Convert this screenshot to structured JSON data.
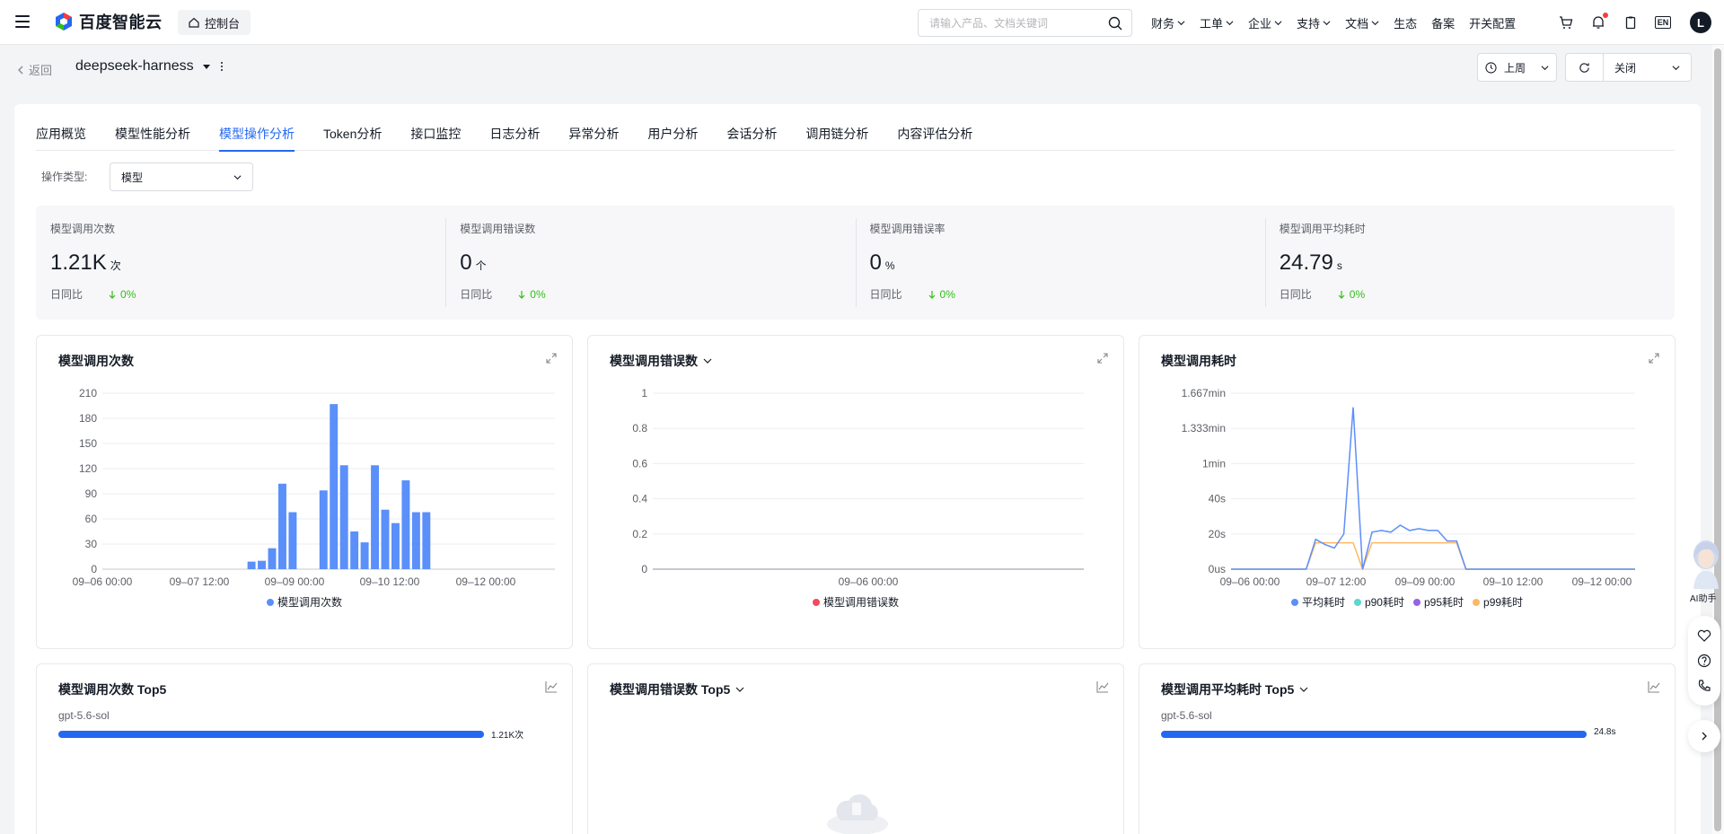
{
  "topnav": {
    "brand": "百度智能云",
    "console_label": "控制台",
    "search_placeholder": "请输入产品、文档关键词",
    "menu": [
      {
        "label": "财务",
        "has_dropdown": true
      },
      {
        "label": "工单",
        "has_dropdown": true
      },
      {
        "label": "企业",
        "has_dropdown": true
      },
      {
        "label": "支持",
        "has_dropdown": true
      },
      {
        "label": "文档",
        "has_dropdown": true
      },
      {
        "label": "生态",
        "has_dropdown": false
      },
      {
        "label": "备案",
        "has_dropdown": false
      },
      {
        "label": "开关配置",
        "has_dropdown": false
      }
    ],
    "lang": "EN",
    "avatar": "L"
  },
  "header": {
    "back_label": "返回",
    "app_name": "deepseek-harness",
    "time_range": "上周",
    "refresh_label": "关闭"
  },
  "tabs": [
    {
      "label": "应用概览",
      "active": false
    },
    {
      "label": "模型性能分析",
      "active": false
    },
    {
      "label": "模型操作分析",
      "active": true
    },
    {
      "label": "Token分析",
      "active": false
    },
    {
      "label": "接口监控",
      "active": false
    },
    {
      "label": "日志分析",
      "active": false
    },
    {
      "label": "异常分析",
      "active": false
    },
    {
      "label": "用户分析",
      "active": false
    },
    {
      "label": "会话分析",
      "active": false
    },
    {
      "label": "调用链分析",
      "active": false
    },
    {
      "label": "内容评估分析",
      "active": false
    }
  ],
  "filter": {
    "label": "操作类型:",
    "value": "模型"
  },
  "stats": [
    {
      "label": "模型调用次数",
      "value": "1.21K",
      "unit": "次",
      "compare_label": "日同比",
      "compare_value": "0%"
    },
    {
      "label": "模型调用错误数",
      "value": "0",
      "unit": "个",
      "compare_label": "日同比",
      "compare_value": "0%"
    },
    {
      "label": "模型调用错误率",
      "value": "0",
      "unit": "%",
      "compare_label": "日同比",
      "compare_value": "0%"
    },
    {
      "label": "模型调用平均耗时",
      "value": "24.79",
      "unit": "s",
      "compare_label": "日同比",
      "compare_value": "0%"
    }
  ],
  "colors": {
    "accent": "#2468f2",
    "bar": "#5b8ff9",
    "error": "#f5495c",
    "p90": "#5ad8d1",
    "p95": "#9861e5",
    "p99": "#ffb766",
    "up_down": "#30bf13"
  },
  "chart_data": [
    {
      "type": "bar",
      "title": "模型调用次数",
      "series": [
        {
          "name": "模型调用次数",
          "values": [
            0,
            0,
            0,
            0,
            0,
            0,
            0,
            0,
            0,
            0,
            0,
            0,
            0,
            0,
            9,
            10,
            25,
            102,
            68,
            0,
            0,
            94,
            197,
            124,
            45,
            32,
            124,
            71,
            55,
            106,
            68,
            68,
            0,
            0,
            0,
            0,
            0,
            0,
            0,
            0,
            0,
            0,
            0,
            0
          ]
        }
      ],
      "x_range": [
        "09-06 00:00",
        "09-12 12:00"
      ],
      "x_ticks": [
        "09–06 00:00",
        "09–07 12:00",
        "09–09 00:00",
        "09–10 12:00",
        "09–12 00:00"
      ],
      "y_ticks": [
        "0",
        "30",
        "60",
        "90",
        "120",
        "150",
        "180",
        "210"
      ],
      "ylim": [
        0,
        210
      ]
    },
    {
      "type": "line",
      "title": "模型调用错误数",
      "series": [
        {
          "name": "模型调用错误数",
          "values": [
            0,
            0
          ]
        }
      ],
      "x_ticks": [
        "09–06 00:00"
      ],
      "y_ticks": [
        "0",
        "0.2",
        "0.4",
        "0.6",
        "0.8",
        "1"
      ],
      "ylim": [
        0,
        1
      ]
    },
    {
      "type": "line",
      "title": "模型调用耗时",
      "y_unit": "seconds",
      "y_ticks": [
        "0us",
        "20s",
        "40s",
        "1min",
        "1.333min",
        "1.667min"
      ],
      "ylim": [
        0,
        100
      ],
      "x_ticks": [
        "09–06 00:00",
        "09–07 12:00",
        "09–09 00:00",
        "09–10 12:00",
        "09–12 00:00"
      ],
      "series": [
        {
          "name": "平均耗时",
          "values": [
            0,
            0,
            0,
            0,
            0,
            0,
            0,
            0,
            0,
            17,
            14,
            12,
            20,
            92,
            0,
            21,
            22,
            21,
            25,
            22,
            23,
            22,
            22,
            16,
            16,
            0,
            0,
            0,
            0,
            0,
            0,
            0,
            0,
            0,
            0,
            0,
            0,
            0,
            0,
            0,
            0,
            0,
            0,
            0
          ]
        },
        {
          "name": "p90耗时",
          "values": []
        },
        {
          "name": "p95耗时",
          "values": []
        },
        {
          "name": "p99耗时",
          "values": [
            0,
            0,
            0,
            0,
            0,
            0,
            0,
            0,
            0,
            15,
            15,
            15,
            15,
            15,
            0,
            15,
            15,
            15,
            15,
            15,
            15,
            15,
            15,
            15,
            15,
            0,
            0,
            0,
            0,
            0,
            0,
            0,
            0,
            0,
            0,
            0,
            0,
            0,
            0,
            0,
            0,
            0,
            0,
            0
          ]
        }
      ]
    }
  ],
  "top5": [
    {
      "title": "模型调用次数 Top5",
      "has_dropdown": false,
      "items": [
        {
          "name": "gpt-5.6-sol",
          "value_label": "1.21K次",
          "ratio": 1.0
        }
      ]
    },
    {
      "title": "模型调用错误数 Top5",
      "has_dropdown": true,
      "items": []
    },
    {
      "title": "模型调用平均耗时 Top5",
      "has_dropdown": true,
      "items": [
        {
          "name": "gpt-5.6-sol",
          "value_label": "24.8s",
          "ratio": 1.0
        }
      ]
    }
  ],
  "side": {
    "ai_label": "AI助手"
  }
}
